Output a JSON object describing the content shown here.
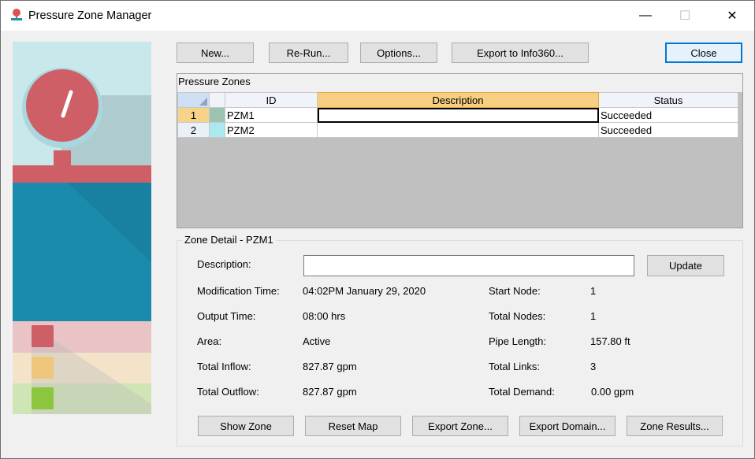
{
  "window": {
    "title": "Pressure Zone Manager",
    "minimize": "—",
    "maximize": "☐",
    "close": "✕"
  },
  "toolbar": {
    "new_label": "New...",
    "rerun_label": "Re-Run...",
    "options_label": "Options...",
    "export_label": "Export to Info360...",
    "close_label": "Close"
  },
  "zones": {
    "caption": "Pressure Zones",
    "columns": [
      "ID",
      "Description",
      "Status"
    ],
    "rows": [
      {
        "num": "1",
        "color": "#9dc4b3",
        "id": "PZM1",
        "description": "",
        "status": "Succeeded"
      },
      {
        "num": "2",
        "color": "#a9e9ef",
        "id": "PZM2",
        "description": "",
        "status": "Succeeded"
      }
    ]
  },
  "detail": {
    "title": "Zone Detail - PZM1",
    "description_label": "Description:",
    "description_value": "",
    "update_label": "Update",
    "modification_time_label": "Modification Time:",
    "modification_time_value": "04:02PM January 29, 2020",
    "output_time_label": "Output Time:",
    "output_time_value": "08:00 hrs",
    "area_label": "Area:",
    "area_value": "Active",
    "total_inflow_label": "Total Inflow:",
    "total_inflow_value": "827.87 gpm",
    "total_outflow_label": "Total Outflow:",
    "total_outflow_value": "827.87 gpm",
    "start_node_label": "Start Node:",
    "start_node_value": "1",
    "total_nodes_label": "Total Nodes:",
    "total_nodes_value": "1",
    "pipe_length_label": "Pipe Length:",
    "pipe_length_value": "157.80 ft",
    "total_links_label": "Total Links:",
    "total_links_value": "3",
    "total_demand_label": "Total Demand:",
    "total_demand_value": "0.00 gpm"
  },
  "actions": {
    "show_zone": "Show Zone",
    "reset_map": "Reset Map",
    "export_zone": "Export Zone...",
    "export_domain": "Export Domain...",
    "zone_results": "Zone Results..."
  },
  "icons": {
    "app": "pressure-gauge-icon",
    "hero": "pressure-gauge-illustration"
  },
  "colors": {
    "accent": "#0078d7",
    "selected_header": "#f6cf81",
    "hero_red": "#cf5f66",
    "hero_blue": "#1a8aad"
  }
}
